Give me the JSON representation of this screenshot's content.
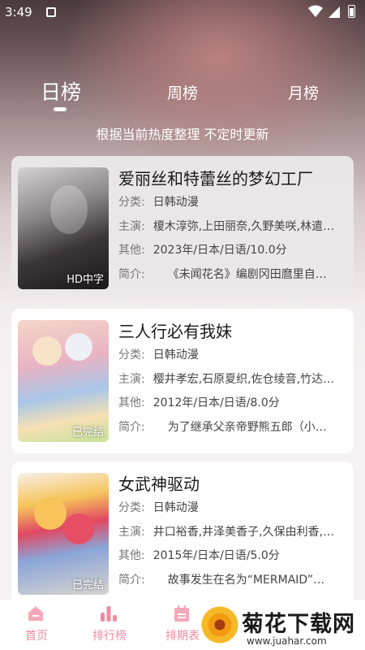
{
  "status": {
    "time": "3:49"
  },
  "tabs": [
    {
      "label": "日榜",
      "active": true
    },
    {
      "label": "周榜",
      "active": false
    },
    {
      "label": "月榜",
      "active": false
    }
  ],
  "subtitle": "根据当前热度整理 不定时更新",
  "items": [
    {
      "title": "爱丽丝和特蕾丝的梦幻工厂",
      "category_label": "分类:",
      "category": "日韩动漫",
      "cast_label": "主演:",
      "cast": "榎木淳弥,上田丽奈,久野美咲,林遣…",
      "other_label": "其他:",
      "other": "2023年/日本/日语/10.0分",
      "intro_label": "简介:",
      "intro": "《未闻花名》编剧冈田麿里自…",
      "badge": "HD中字"
    },
    {
      "title": "三人行必有我妹",
      "category_label": "分类:",
      "category": "日韩动漫",
      "cast_label": "主演:",
      "cast": "樱井孝宏,石原夏织,佐仓绫音,竹达…",
      "other_label": "其他:",
      "other": "2012年/日本/日语/8.0分",
      "intro_label": "简介:",
      "intro": "为了继承父亲帝野熊五郎（小…",
      "badge": "已完结"
    },
    {
      "title": "女武神驱动",
      "category_label": "分类:",
      "category": "日韩动漫",
      "cast_label": "主演:",
      "cast": "井口裕香,井泽美香子,久保由利香,…",
      "other_label": "其他:",
      "other": "2015年/日本/日语/5.0分",
      "intro_label": "简介:",
      "intro": "故事发生在名为“MERMAID”…",
      "badge": "已完结"
    }
  ],
  "nav": {
    "home": "首页",
    "rank": "排行榜",
    "schedule": "排期表"
  },
  "watermark": {
    "title": "菊花下载网",
    "url": "www.juahar.com"
  },
  "colors": {
    "accent": "#f08aa1"
  }
}
